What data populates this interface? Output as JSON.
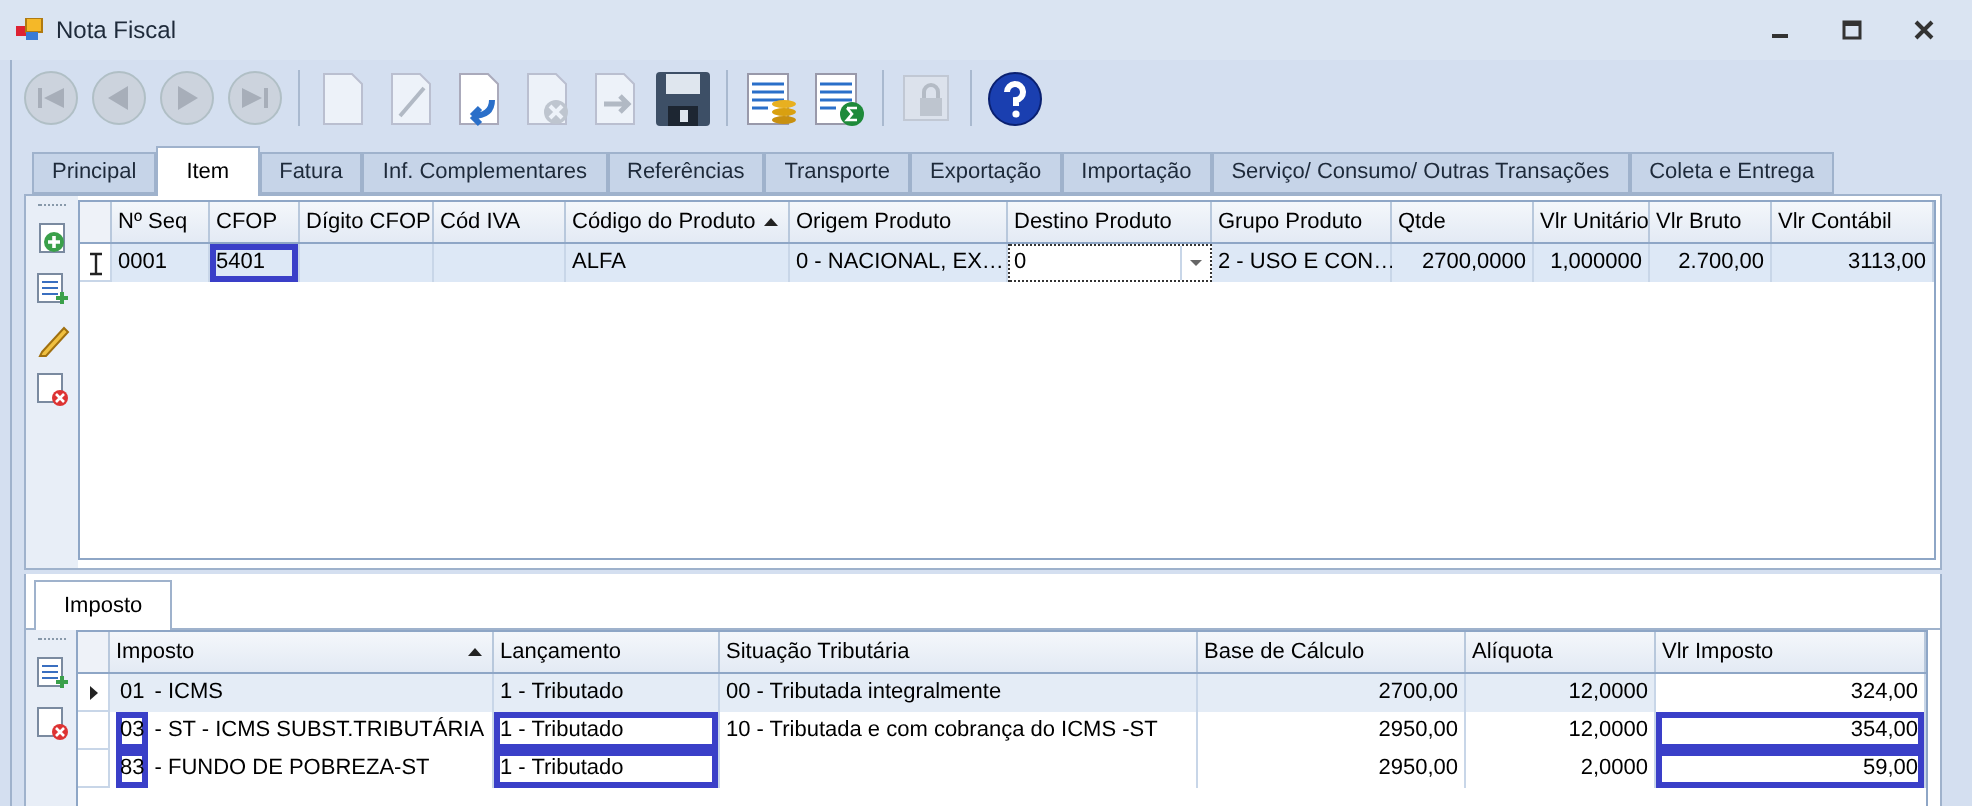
{
  "window": {
    "title": "Nota Fiscal"
  },
  "toolbar": [
    {
      "kind": "first",
      "disabled": true
    },
    {
      "kind": "prev",
      "disabled": true
    },
    {
      "kind": "next",
      "disabled": true
    },
    {
      "kind": "last",
      "disabled": true
    },
    {
      "kind": "sep"
    },
    {
      "kind": "new",
      "disabled": true
    },
    {
      "kind": "edit",
      "disabled": true
    },
    {
      "kind": "undo",
      "disabled": false
    },
    {
      "kind": "cancel",
      "disabled": true
    },
    {
      "kind": "redo",
      "disabled": true
    },
    {
      "kind": "save",
      "disabled": false
    },
    {
      "kind": "sep"
    },
    {
      "kind": "report",
      "disabled": false
    },
    {
      "kind": "sum",
      "disabled": false
    },
    {
      "kind": "sep"
    },
    {
      "kind": "lock",
      "disabled": true
    },
    {
      "kind": "sep"
    },
    {
      "kind": "help",
      "disabled": false
    }
  ],
  "tabs": [
    {
      "label": "Principal",
      "selected": false
    },
    {
      "label": "Item",
      "selected": true
    },
    {
      "label": "Fatura",
      "selected": false
    },
    {
      "label": "Inf. Complementares",
      "selected": false
    },
    {
      "label": "Referências",
      "selected": false
    },
    {
      "label": "Transporte",
      "selected": false
    },
    {
      "label": "Exportação",
      "selected": false
    },
    {
      "label": "Importação",
      "selected": false
    },
    {
      "label": "Serviço/ Consumo/ Outras Transações",
      "selected": false
    },
    {
      "label": "Coleta e Entrega",
      "selected": false
    }
  ],
  "item_side_tools": [
    {
      "kind": "add"
    },
    {
      "kind": "list"
    },
    {
      "kind": "edit"
    },
    {
      "kind": "delete"
    }
  ],
  "items_table": {
    "columns": [
      {
        "label": "Nº Seq",
        "sorted": false
      },
      {
        "label": "CFOP",
        "sorted": false
      },
      {
        "label": "Dígito CFOP",
        "sorted": false
      },
      {
        "label": "Cód IVA",
        "sorted": false
      },
      {
        "label": "Código do Produto",
        "sorted": true
      },
      {
        "label": "Origem Produto",
        "sorted": false
      },
      {
        "label": "Destino Produto",
        "sorted": false
      },
      {
        "label": "Grupo Produto",
        "sorted": false
      },
      {
        "label": "Qtde",
        "sorted": false
      },
      {
        "label": "Vlr Unitário",
        "sorted": false
      },
      {
        "label": "Vlr Bruto",
        "sorted": false
      },
      {
        "label": "Vlr Contábil",
        "sorted": false
      }
    ],
    "rows": [
      {
        "selected": true,
        "cells": [
          {
            "text": "0001",
            "highlighted": false
          },
          {
            "text": "5401",
            "highlighted": true
          },
          {
            "text": "",
            "highlighted": false
          },
          {
            "text": "",
            "highlighted": false
          },
          {
            "text": "ALFA",
            "highlighted": false
          },
          {
            "text": "0 - NACIONAL, EX…",
            "highlighted": false
          },
          {
            "text": "0",
            "kind": "dropdown",
            "highlighted": false
          },
          {
            "text": "2 - USO E CON…",
            "highlighted": false
          },
          {
            "text": "2700,0000",
            "highlighted": false
          },
          {
            "text": "1,000000",
            "highlighted": false
          },
          {
            "text": "2.700,00",
            "highlighted": false
          },
          {
            "text": "3113,00",
            "highlighted": false
          }
        ]
      }
    ]
  },
  "tax_tabs": [
    {
      "label": "Imposto",
      "selected": true
    }
  ],
  "tax_side_tools": [
    {
      "kind": "list"
    },
    {
      "kind": "delete"
    }
  ],
  "tax_table": {
    "columns": [
      {
        "label": "Imposto",
        "sorted": true
      },
      {
        "label": "Lançamento",
        "sorted": false
      },
      {
        "label": "Situação Tributária",
        "sorted": false
      },
      {
        "label": "Base de Cálculo",
        "sorted": false
      },
      {
        "label": "Alíquota",
        "sorted": false
      },
      {
        "label": "Vlr Imposto",
        "sorted": false
      }
    ],
    "rows": [
      {
        "selected": true,
        "cells": [
          {
            "code": "01",
            "label": "- ICMS",
            "highlighted": false
          },
          {
            "text": "1 - Tributado",
            "highlighted": false
          },
          {
            "text": "00 - Tributada integralmente",
            "highlighted": false
          },
          {
            "text": "2700,00",
            "highlighted": false
          },
          {
            "text": "12,0000",
            "highlighted": false
          },
          {
            "text": "324,00",
            "highlighted": false
          }
        ]
      },
      {
        "selected": false,
        "cells": [
          {
            "code": "03",
            "label": "- ST - ICMS SUBST.TRIBUTÁRIA",
            "highlighted": true
          },
          {
            "text": "1 - Tributado",
            "highlighted": true
          },
          {
            "text": "10 - Tributada e com cobrança do ICMS -ST",
            "highlighted": false
          },
          {
            "text": "2950,00",
            "highlighted": false
          },
          {
            "text": "12,0000",
            "highlighted": false
          },
          {
            "text": "354,00",
            "highlighted": true
          }
        ]
      },
      {
        "selected": false,
        "cells": [
          {
            "code": "83",
            "label": "- FUNDO DE POBREZA-ST",
            "highlighted": true
          },
          {
            "text": "1 - Tributado",
            "highlighted": true
          },
          {
            "text": "",
            "highlighted": false
          },
          {
            "text": "2950,00",
            "highlighted": false
          },
          {
            "text": "2,0000",
            "highlighted": false
          },
          {
            "text": "59,00",
            "highlighted": true
          }
        ]
      }
    ]
  }
}
